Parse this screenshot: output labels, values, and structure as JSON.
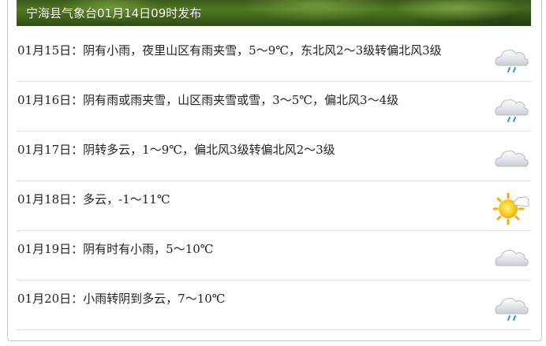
{
  "header": {
    "title": "宁海县气象台01月14日09时发布"
  },
  "forecast": [
    {
      "text": "01月15日：阴有小雨，夜里山区有雨夹雪，5～9℃，东北风2～3级转偏北风3级",
      "icon": "light-rain-icon"
    },
    {
      "text": "01月16日：阴有雨或雨夹雪，山区雨夹雪或雪，3～5℃，偏北风3～4级",
      "icon": "light-rain-icon"
    },
    {
      "text": "01月17日：阴转多云，1～9℃，偏北风3级转偏北风2～3级",
      "icon": "cloudy-icon"
    },
    {
      "text": "01月18日：多云，-1～11℃",
      "icon": "partly-cloudy-sun-icon"
    },
    {
      "text": "01月19日：阴有时有小雨，5～10℃",
      "icon": "cloudy-icon"
    },
    {
      "text": "01月20日：小雨转阴到多云，7～10℃",
      "icon": "light-rain-icon"
    }
  ],
  "colors": {
    "text": "#222222",
    "divider": "#e2e2e2",
    "banner": "#4f7a22"
  }
}
